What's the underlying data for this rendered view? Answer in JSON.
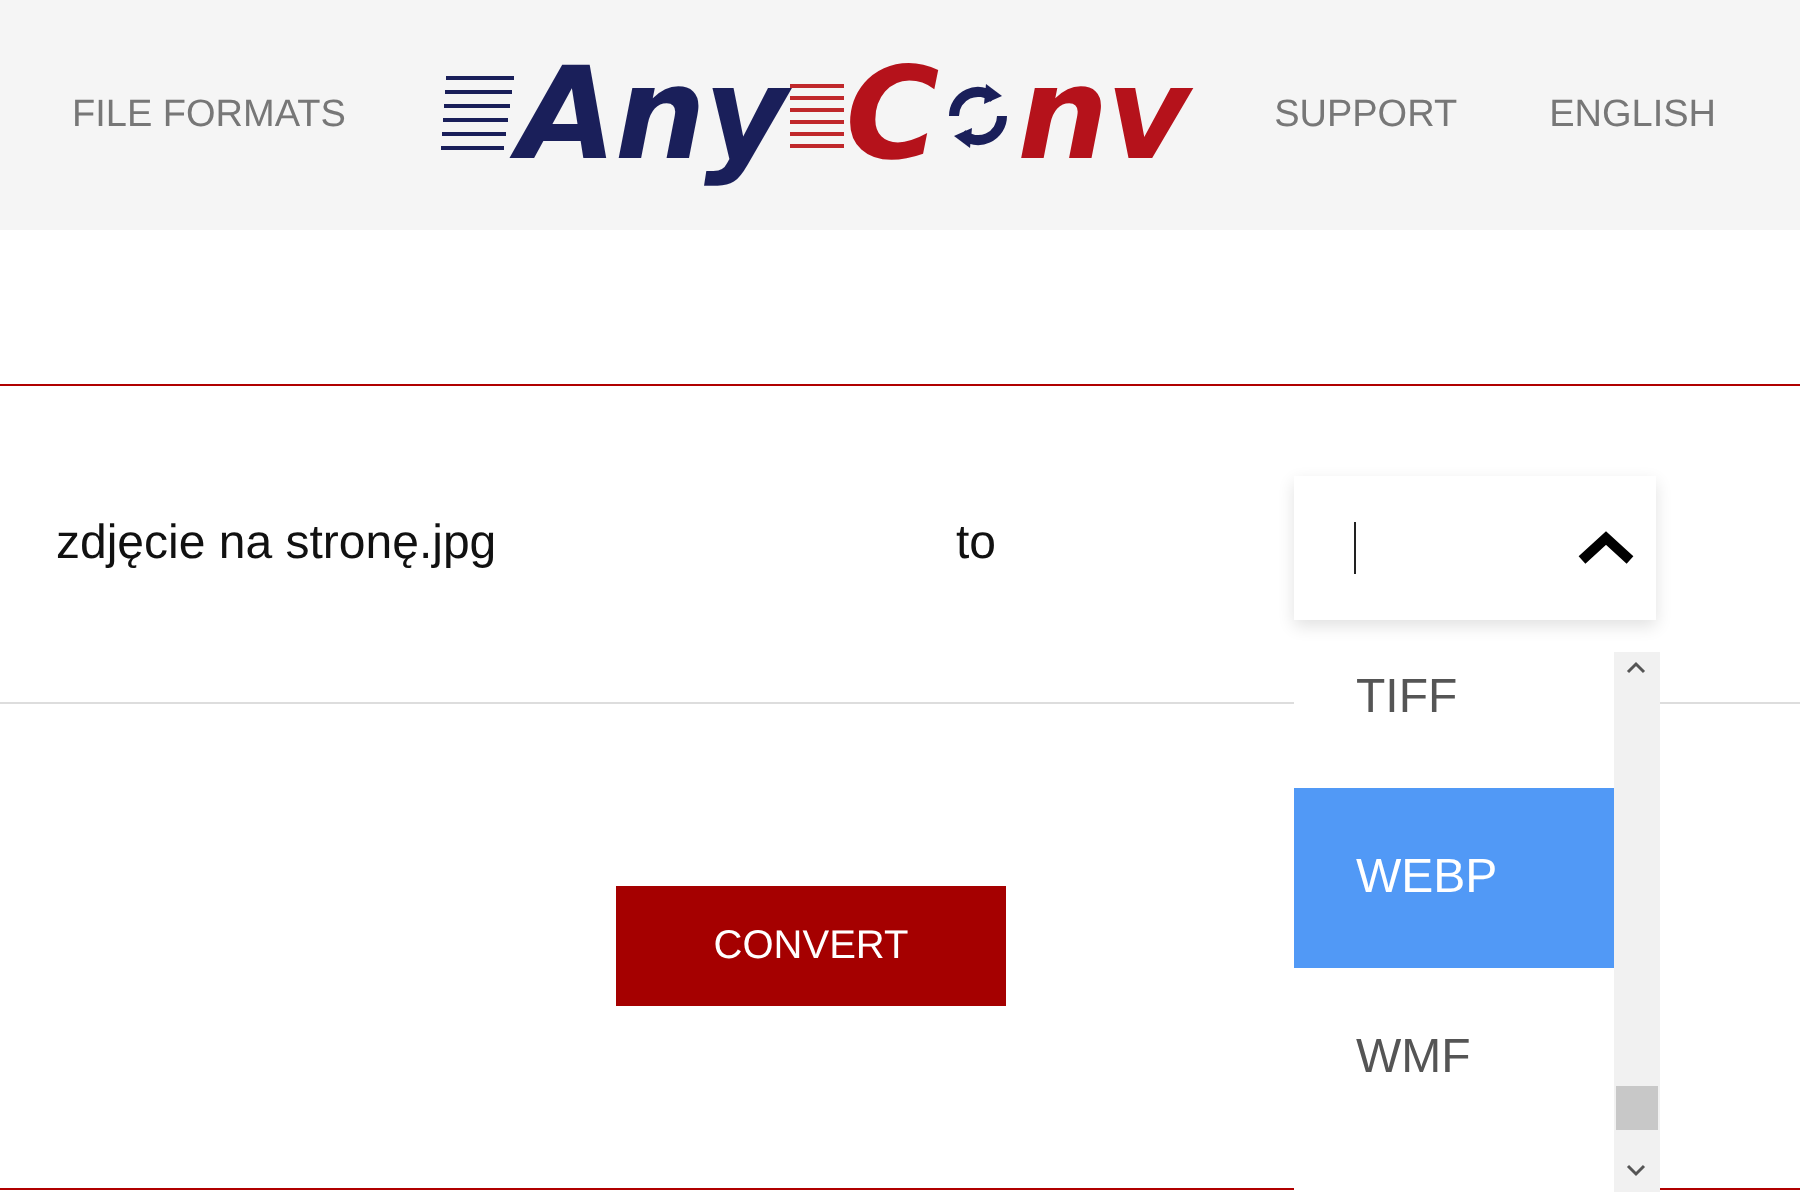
{
  "nav": {
    "left": "FILE FORMATS",
    "right": [
      "SUPPORT",
      "ENGLISH"
    ]
  },
  "logo": {
    "part_1": "Any",
    "part_2": "C",
    "part_3": "nv"
  },
  "file": {
    "name": "zdjęcie na stronę.jpg",
    "to": "to"
  },
  "format_select": {
    "expanded": true
  },
  "options": [
    {
      "label": "TIFF",
      "selected": false
    },
    {
      "label": "WEBP",
      "selected": true
    },
    {
      "label": "WMF",
      "selected": false
    }
  ],
  "convert_button": "CONVERT"
}
